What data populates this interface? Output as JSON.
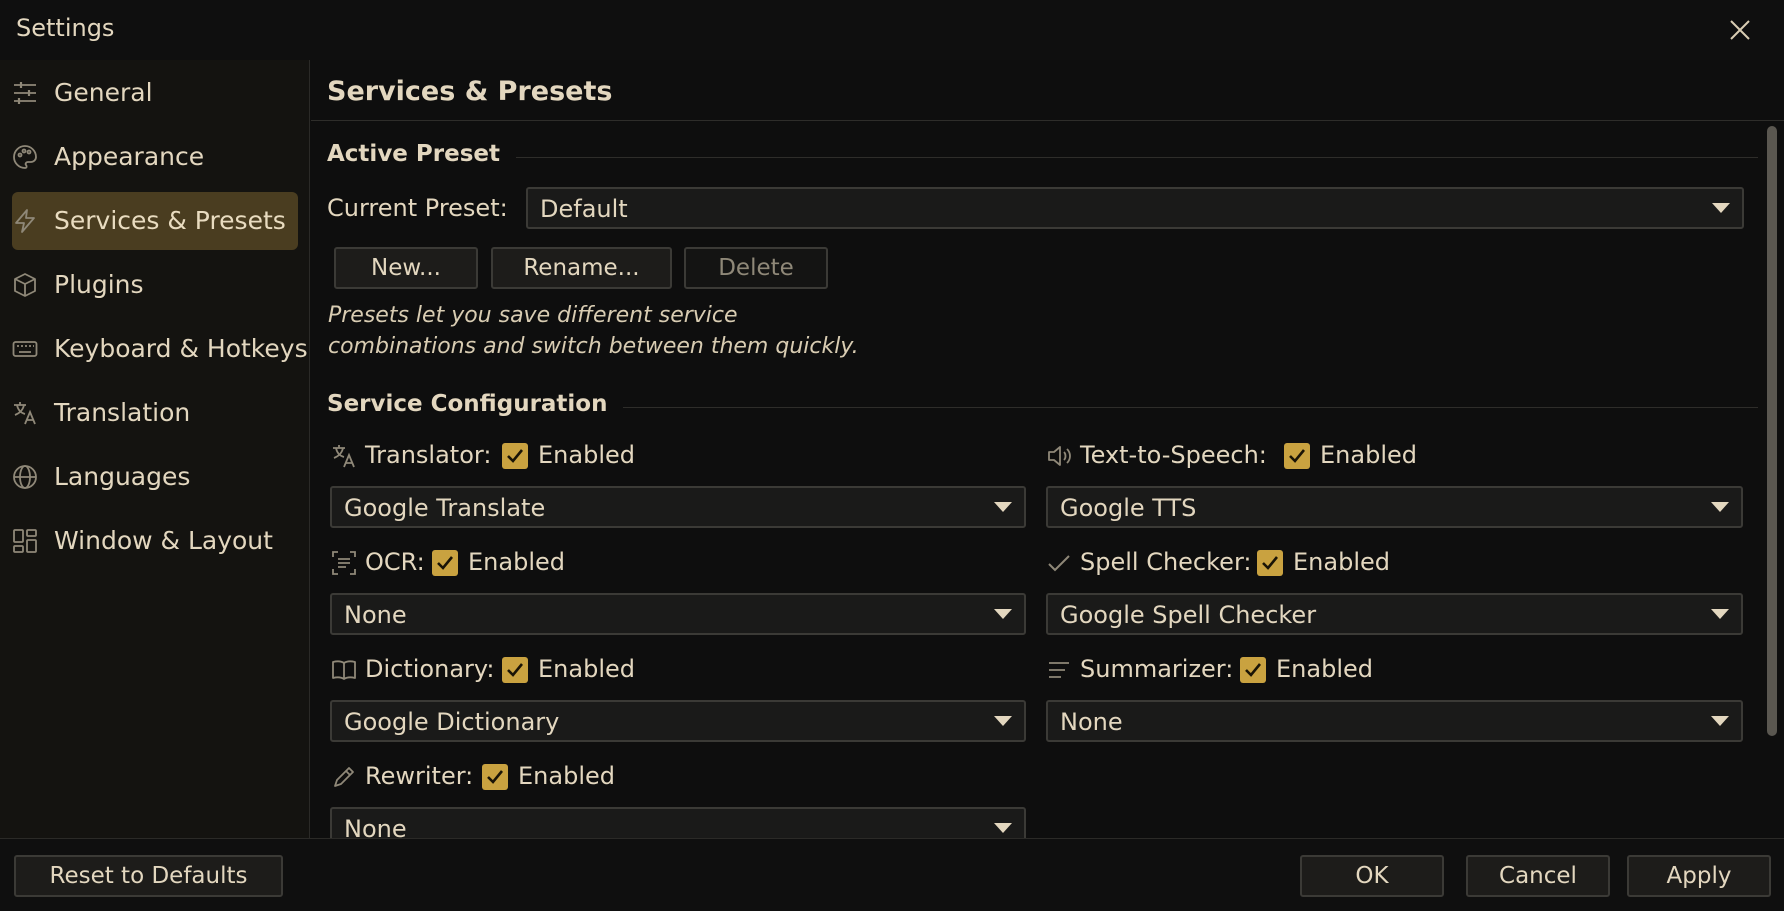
{
  "window": {
    "title": "Settings"
  },
  "sidebar": {
    "items": [
      {
        "label": "General",
        "icon": "sliders-icon"
      },
      {
        "label": "Appearance",
        "icon": "palette-icon"
      },
      {
        "label": "Services & Presets",
        "icon": "lightning-icon",
        "active": true
      },
      {
        "label": "Plugins",
        "icon": "package-icon"
      },
      {
        "label": "Keyboard & Hotkeys",
        "icon": "keyboard-icon"
      },
      {
        "label": "Translation",
        "icon": "translate-icon"
      },
      {
        "label": "Languages",
        "icon": "globe-icon"
      },
      {
        "label": "Window & Layout",
        "icon": "layout-icon"
      }
    ]
  },
  "main": {
    "title": "Services & Presets",
    "active_preset": {
      "heading": "Active Preset",
      "current_label": "Current Preset:",
      "current_value": "Default",
      "new_label": "New...",
      "rename_label": "Rename...",
      "delete_label": "Delete",
      "hint_line1": "Presets let you save different service",
      "hint_line2": "combinations and switch between them quickly."
    },
    "services": {
      "heading": "Service Configuration",
      "enabled_label": "Enabled",
      "translator": {
        "label": "Translator:",
        "value": "Google Translate"
      },
      "tts": {
        "label": "Text-to-Speech:",
        "value": "Google TTS"
      },
      "ocr": {
        "label": "OCR:",
        "value": "None"
      },
      "spell": {
        "label": "Spell Checker:",
        "value": "Google Spell Checker"
      },
      "dictionary": {
        "label": "Dictionary:",
        "value": "Google Dictionary"
      },
      "summarizer": {
        "label": "Summarizer:",
        "value": "None"
      },
      "rewriter": {
        "label": "Rewriter:",
        "value": "None"
      }
    }
  },
  "footer": {
    "reset_label": "Reset to Defaults",
    "ok_label": "OK",
    "cancel_label": "Cancel",
    "apply_label": "Apply"
  },
  "colors": {
    "accent": "#c9a240",
    "active_nav": "#4a3d20",
    "background": "#0e0e0e"
  }
}
